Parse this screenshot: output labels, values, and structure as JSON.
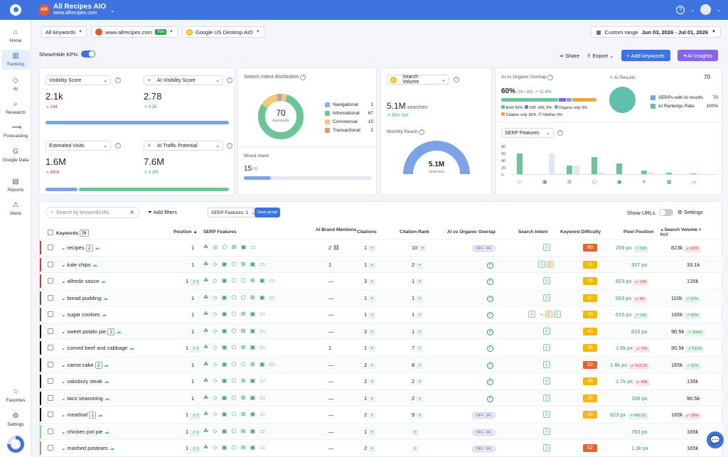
{
  "project": {
    "avatar": "AIR",
    "title": "All Recipes AIO",
    "url": "www.allrecipes.com"
  },
  "sidebar": [
    {
      "label": "Home",
      "icon": "⌂"
    },
    {
      "label": "Ranking",
      "icon": "▥"
    },
    {
      "label": "AI",
      "icon": "◇"
    },
    {
      "label": "Research",
      "icon": "⌕"
    },
    {
      "label": "Forecasting",
      "icon": "⟿"
    },
    {
      "label": "Google Data",
      "icon": "G"
    },
    {
      "label": "Reports",
      "icon": "▤"
    },
    {
      "label": "Alerts",
      "icon": "⚠"
    },
    {
      "label": "Favorites",
      "icon": "☆"
    },
    {
      "label": "Settings",
      "icon": "⚙"
    }
  ],
  "filters": {
    "keywords": "All keywords",
    "domain": "www.allrecipes.com",
    "you": "You",
    "engine": "Google US Desktop AIO"
  },
  "daterange": {
    "label": "Custom range",
    "value": "Jun 03, 2026 - Jul 01, 2026"
  },
  "kpi_toggle": "Show/Hide KPIs",
  "actions": {
    "share": "Share",
    "export": "Export",
    "add": "+ Add keywords",
    "insights": "AI Insights"
  },
  "kpis": [
    {
      "label": "Visibility Score",
      "value": "2.1k",
      "delta": "144",
      "dir": "down"
    },
    {
      "label": "AI Visibility Score",
      "value": "2.78",
      "delta": "0.24",
      "dir": "up"
    },
    {
      "label": "Estimated Visits",
      "value": "1.6M",
      "delta": "680k",
      "dir": "down"
    },
    {
      "label": "AI Traffic Potential",
      "value": "7.6M",
      "delta": "1.2M",
      "dir": "up"
    }
  ],
  "intent": {
    "title": "Search Intent distribution",
    "total": "70",
    "total_label": "keywords",
    "items": [
      {
        "label": "Navigational",
        "value": "1",
        "color": "#8fb0e8"
      },
      {
        "label": "Informational",
        "value": "67",
        "color": "#6cc49a"
      },
      {
        "label": "Commercial",
        "value": "15",
        "color": "#f4c97a"
      },
      {
        "label": "Transactional",
        "value": "2",
        "color": "#ec8f7f"
      }
    ],
    "mixed_label": "Mixed intent",
    "mixed_value": "15",
    "mixed_total": "/70"
  },
  "volume": {
    "label": "Search Volume",
    "value": "5.1M",
    "unit": "searches",
    "yoy": "33% YoY",
    "reach_label": "Monthly Reach",
    "reach_value": "5.1M",
    "reach_unit": "searches"
  },
  "overlap": {
    "title": "AI vs Organic Overlap",
    "pct": "60%",
    "ratio": "(39 / 65)",
    "delta": "21.9%",
    "legend": [
      "Both 60%",
      "Diff. URL 8%",
      "Organic only 5%",
      "Citation only 26%",
      "Neither 0%"
    ]
  },
  "ai_results": {
    "title": "AI Results",
    "value": "70",
    "rows": [
      {
        "label": "SERPs with AI results",
        "value": "70"
      },
      {
        "label": "AI Rankings Rate",
        "value": "100%"
      }
    ]
  },
  "serp_chart": {
    "label": "SERP Features",
    "ylabels": [
      "80",
      "60",
      "40",
      "20",
      "0"
    ],
    "bars": [
      {
        "a": 0.0,
        "b": 0.72
      },
      {
        "a": 0.72,
        "b": 0.0
      },
      {
        "a": 0.3,
        "b": 0.3
      },
      {
        "a": 0.1,
        "b": 0.6
      },
      {
        "a": 0.0,
        "b": 0.38
      },
      {
        "a": 0.1,
        "b": 0.15
      },
      {
        "a": 0.0,
        "b": 0.06
      },
      {
        "a": 0.0,
        "b": 0.04
      },
      {
        "a": 0.0,
        "b": 0.0
      },
      {
        "a": 0.0,
        "b": 0.0
      }
    ]
  },
  "table": {
    "search_placeholder": "Search by keyword/URL",
    "add_filters": "Add filters",
    "chip": "SERP Features: 1",
    "save_group": "Save group",
    "show_urls": "Show URLs",
    "settings": "Settings",
    "headers": {
      "keywords": "Keywords",
      "kw_count": "70",
      "position": "Position ▲",
      "serp": "SERP Features",
      "brand": "AI Brand Mentions",
      "citations": "Citations",
      "citation_rank": "Citation Rank",
      "overlap": "AI vs Organic Overlap",
      "intent": "Search Intent",
      "kd": "Keyword Difficulty",
      "pixel": "Pixel Position",
      "volume": "Search Volume + YoY"
    },
    "rows": [
      {
        "kw": "recipes",
        "badge": "2",
        "bar": "#d33",
        "pos": "1",
        "posdelta": "",
        "serp": "☘ ◎ ⬠ ⊞ ▣ ▭",
        "brand": "2 ⛓",
        "cit": "1",
        "cr": "10",
        "overlap": "DIFF. URL",
        "intent": [
          "I"
        ],
        "kd": "60",
        "kdc": "#e8632b",
        "pix": "259 px",
        "pixd": "329",
        "pixdir": "up",
        "vol": "823k",
        "vold": "63%",
        "voldir": "dn"
      },
      {
        "kw": "kale chips",
        "badge": "",
        "bar": "#d33",
        "pos": "1",
        "posdelta": "",
        "serp": "☘ ◇ ▣ ⬠ ⊞ ▣ ▭",
        "brand": "1",
        "cit": "1",
        "cr": "2",
        "overlap": "✓",
        "intent": [
          "I",
          "C"
        ],
        "kd": "41",
        "kdc": "#f5b700",
        "pix": "337 px",
        "pixd": "",
        "pixdir": "",
        "vol": "33.1k",
        "vold": "",
        "voldir": ""
      },
      {
        "kw": "alfredo sauce",
        "badge": "",
        "bar": "#d33",
        "pos": "1",
        "posdelta": "2",
        "serp": "☘ ◇ ▣ ⬠ ⬠ ⊞ ▣ ▭",
        "brand": "—",
        "cit": "3",
        "cr": "1",
        "overlap": "✓",
        "intent": [
          "I"
        ],
        "kd": "39",
        "kdc": "#f5b700",
        "pix": "823 px",
        "pixd": "134",
        "pixdir": "dn",
        "vol": "135k",
        "vold": "",
        "voldir": ""
      },
      {
        "kw": "bread pudding",
        "badge": "",
        "bar": "#555",
        "pos": "1",
        "posdelta": "",
        "serp": "☘ ◇ ▣ ⬠ ⬠ ⊞ ▣ ▭",
        "brand": "—",
        "cit": "1",
        "cr": "1",
        "overlap": "✓",
        "intent": [
          "I"
        ],
        "kd": "47",
        "kdc": "#f5b700",
        "pix": "653 px",
        "pixd": "40",
        "pixdir": "dn",
        "vol": "110k",
        "vold": "22%",
        "voldir": "up"
      },
      {
        "kw": "sugar cookies",
        "badge": "",
        "bar": "#555",
        "pos": "1",
        "posdelta": "",
        "serp": "☘ ◇ ▣ ⬠ ⊞ ▣ ▭",
        "brand": "—",
        "cit": "1",
        "cr": "1",
        "overlap": "✓",
        "intent": [
          "I",
          "→",
          "C",
          "I"
        ],
        "kd": "43",
        "kdc": "#f5b700",
        "pix": "615 px",
        "pixd": "742",
        "pixdir": "up",
        "vol": "165k",
        "vold": "50%",
        "voldir": "up"
      },
      {
        "kw": "sweet potato pie",
        "badge": "2",
        "bar": "#111",
        "pos": "1",
        "posdelta": "",
        "serp": "☘ ◇ ▣ ⬠ ⊞ ▣ ▭",
        "brand": "—",
        "cit": "2",
        "cr": "1",
        "overlap": "✓",
        "intent": [
          "I"
        ],
        "kd": "41",
        "kdc": "#f5b700",
        "pix": "615 px",
        "pixd": "",
        "pixdir": "",
        "vol": "90.5k",
        "vold": "308%",
        "voldir": "up"
      },
      {
        "kw": "corned beef and cabbage",
        "badge": "",
        "bar": "#111",
        "pos": "1",
        "posdelta": "2",
        "serp": "☘ ◇ ▣ ⬠ ⊞ ▣ ▭",
        "brand": "1",
        "cit": "1",
        "cr": "7",
        "overlap": "✓",
        "intent": [
          "I"
        ],
        "kd": "35",
        "kdc": "#f5b700",
        "pix": "1.6k px",
        "pixd": "796",
        "pixdir": "dn",
        "vol": "90.5k",
        "vold": "511%",
        "voldir": "up"
      },
      {
        "kw": "carrot cake",
        "badge": "2",
        "bar": "#111",
        "pos": "1",
        "posdelta": "",
        "serp": "☘ ◇ ▣ ⬠ ⬠ ⊞ ▣ ▭",
        "brand": "—",
        "cit": "2",
        "cr": "8",
        "overlap": "✓",
        "intent": [
          "I"
        ],
        "kd": "52",
        "kdc": "#e8632b",
        "pix": "1.8k px",
        "pixd": "513.22",
        "pixdir": "dn",
        "vol": "165k",
        "vold": "22%",
        "voldir": "up"
      },
      {
        "kw": "salisbury steak",
        "badge": "",
        "bar": "#111",
        "pos": "1",
        "posdelta": "",
        "serp": "☘ ◇ ▣ ⬠ ⊞ ▣ ▭",
        "brand": "—",
        "cit": "2",
        "cr": "2",
        "overlap": "✓",
        "intent": [
          "I"
        ],
        "kd": "49",
        "kdc": "#f5b700",
        "pix": "1.7k px",
        "pixd": "408",
        "pixdir": "dn",
        "vol": "135k",
        "vold": "",
        "voldir": ""
      },
      {
        "kw": "taco seasoning",
        "badge": "",
        "bar": "#111",
        "pos": "1",
        "posdelta": "",
        "serp": "☘ ◇ ▣ ⬠ ⊞ ▣ ▭",
        "brand": "—",
        "cit": "1",
        "cr": "2",
        "overlap": "✓",
        "intent": [
          "I"
        ],
        "kd": "38",
        "kdc": "#f5b700",
        "pix": "166 px",
        "pixd": "",
        "pixdir": "",
        "vol": "90.5k",
        "vold": "",
        "voldir": ""
      },
      {
        "kw": "meatloaf",
        "badge": "2",
        "bar": "#111",
        "pos": "1",
        "posdelta": "3",
        "serp": "☘ ◇ ▣ ⬠ ⊞ ▣ ▭",
        "brand": "—",
        "cit": "2",
        "cr": "9",
        "overlap": "DIFF. URL",
        "intent": [
          "I"
        ],
        "kd": "43",
        "kdc": "#f5b700",
        "pix": "823 px",
        "pixd": "400.22",
        "pixdir": "up",
        "vol": "165k",
        "vold": "18%",
        "voldir": "dn"
      },
      {
        "kw": "chicken pot pie",
        "badge": "",
        "bar": "#7cd97c",
        "pos": "1",
        "posdelta": "2",
        "serp": "☘ ◇ ▣ ⬠ ⊞ ▣ ▭",
        "brand": "—",
        "cit": "1",
        "cr": "",
        "overlap": "DIFF. URL",
        "intent": [
          "I"
        ],
        "kd": "",
        "kdc": "#f5b700",
        "pix": "783 px",
        "pixd": "",
        "pixdir": "",
        "vol": "165k",
        "vold": "",
        "voldir": ""
      },
      {
        "kw": "mashed potatoes",
        "badge": "",
        "bar": "#999",
        "pos": "1",
        "posdelta": "2",
        "serp": "☘ ◇ ▣ ⬠ ⊞ ▣ ▭",
        "brand": "—",
        "cit": "2",
        "cr": "",
        "overlap": "DIFF. URL",
        "intent": [
          "I"
        ],
        "kd": "52",
        "kdc": "#e8632b",
        "pix": "1.3k px",
        "pixd": "",
        "pixdir": "",
        "vol": "165k",
        "vold": "",
        "voldir": ""
      }
    ]
  }
}
